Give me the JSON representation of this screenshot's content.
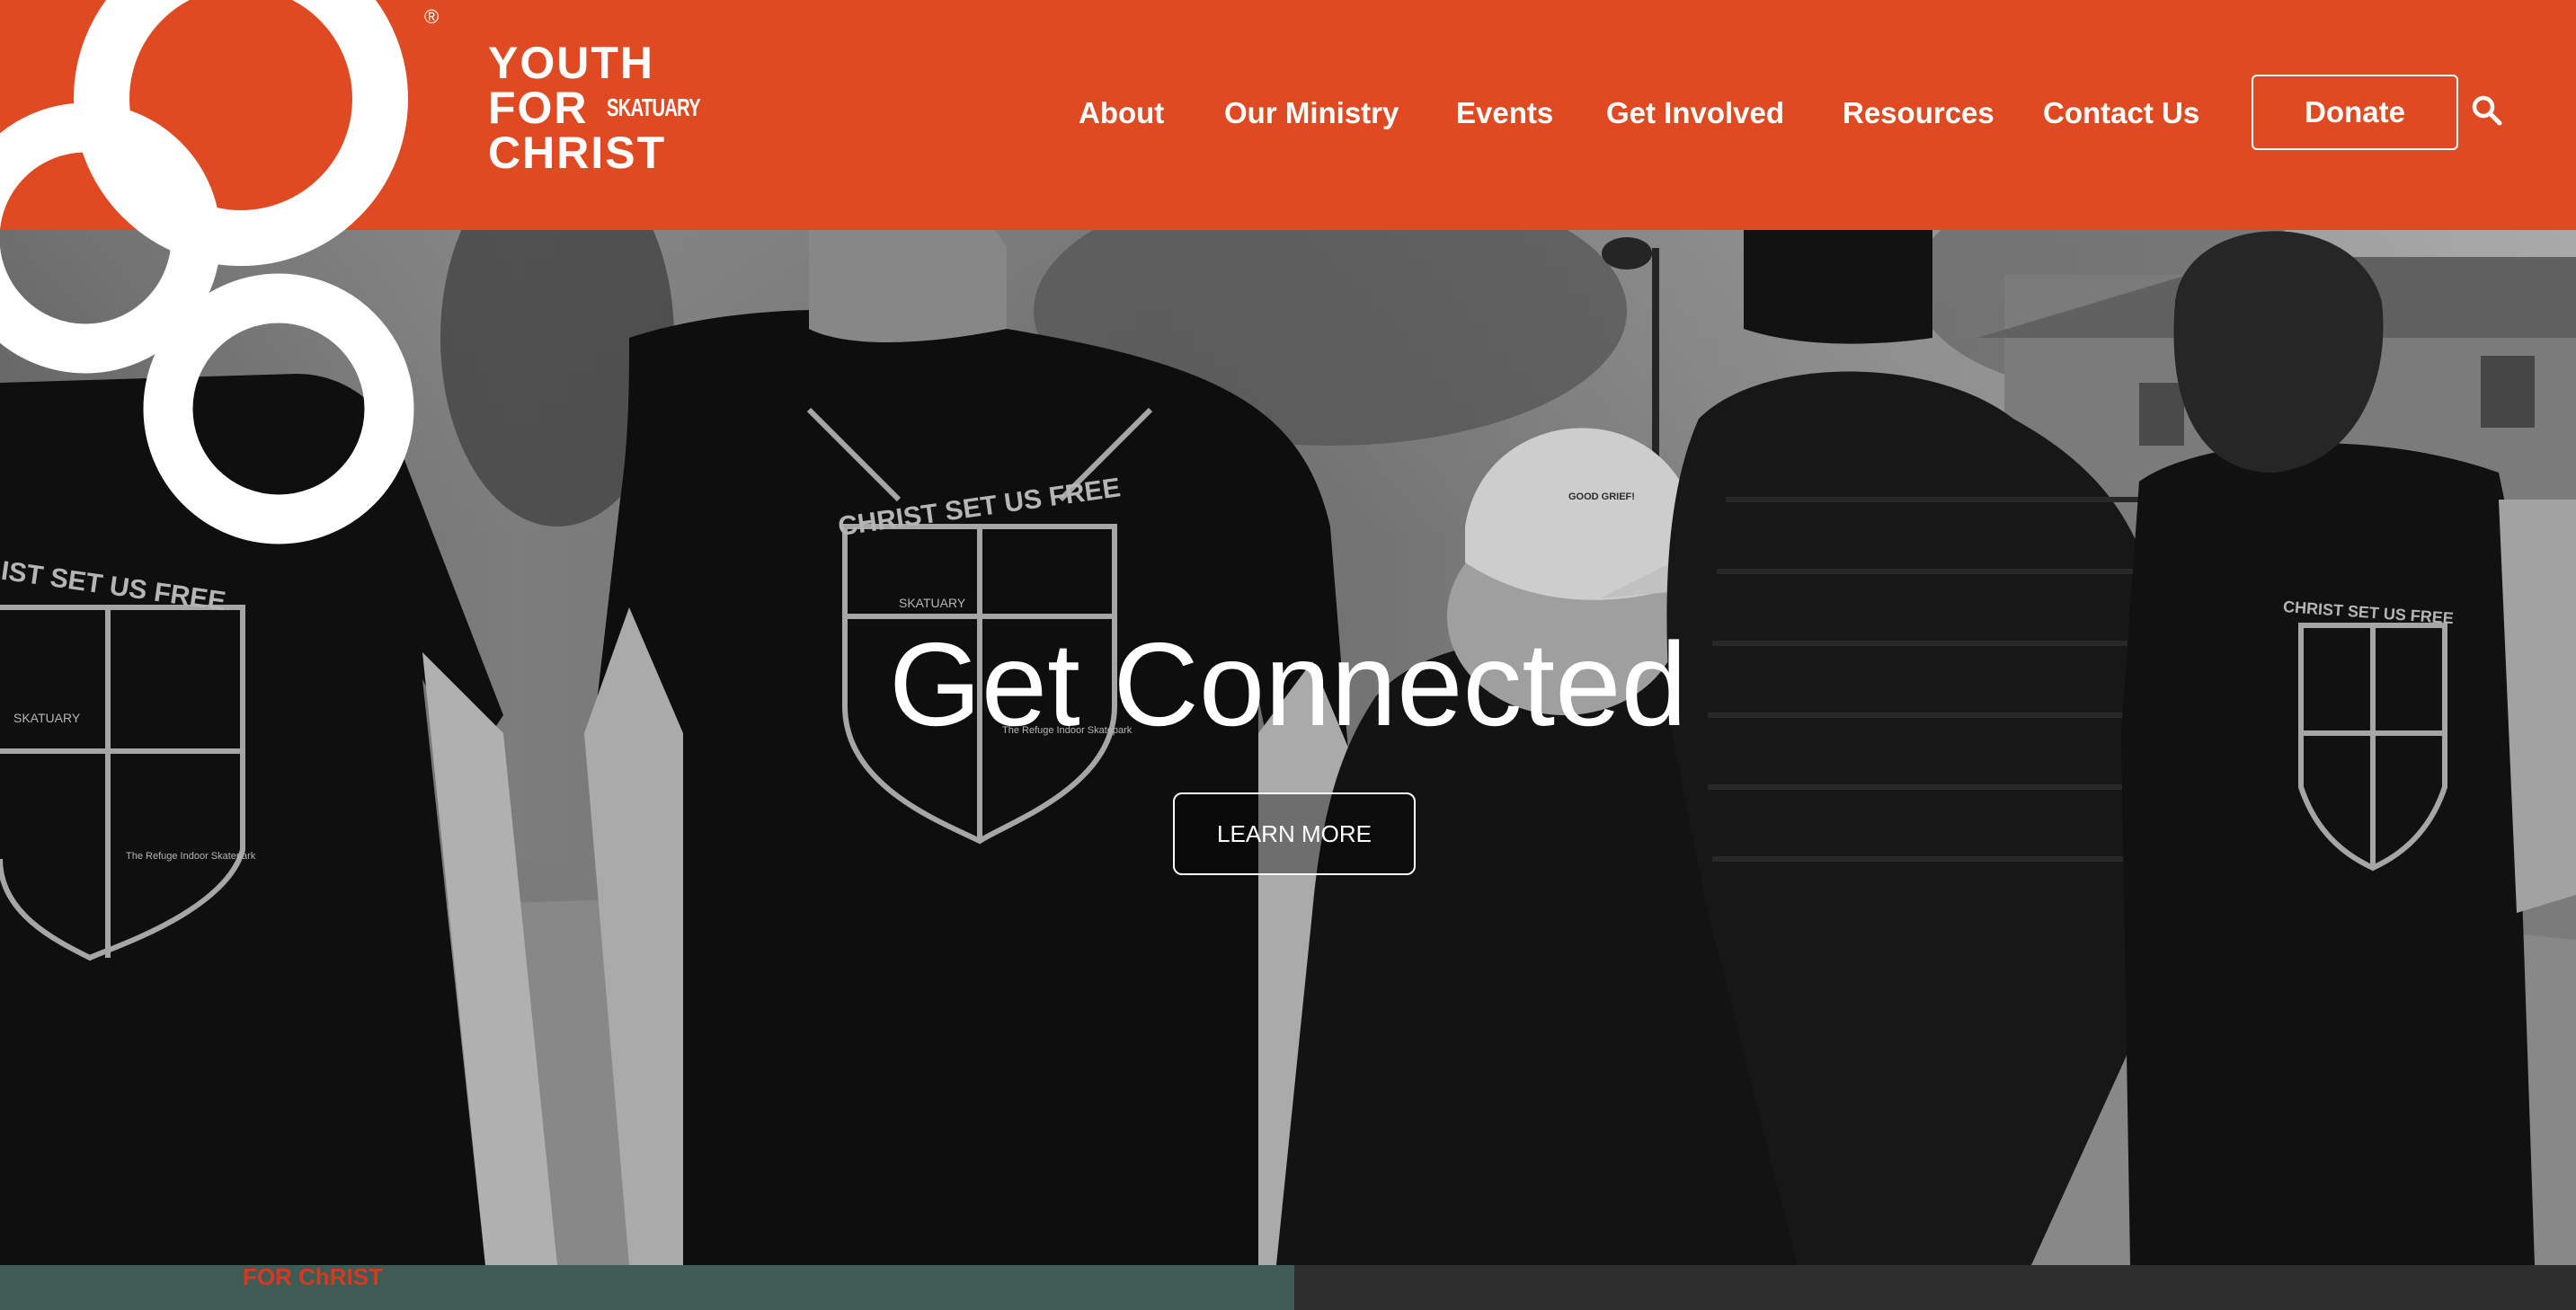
{
  "brand": {
    "line1": "YOUTH",
    "line2": "FOR",
    "line3": "CHRIST",
    "sub": "SKATUARY",
    "registered": "®"
  },
  "nav": {
    "items": [
      "About",
      "Our Ministry",
      "Events",
      "Get Involved",
      "Resources",
      "Contact Us"
    ],
    "donate": "Donate",
    "search_icon": "search-icon"
  },
  "hero": {
    "title": "Get Connected",
    "button": "LEARN MORE"
  },
  "shirt_print": {
    "banner": "CHRIST SET US FREE",
    "banner_partial": "IST SET US FREE",
    "badge": "SKATUARY",
    "caption": "The Refuge Indoor Skatepark",
    "cap": "GOOD GRIEF!"
  },
  "bottom_strip": {
    "left_text": "FOR ChRIST"
  },
  "colors": {
    "brand_orange": "#df4a22",
    "white": "#ffffff"
  }
}
